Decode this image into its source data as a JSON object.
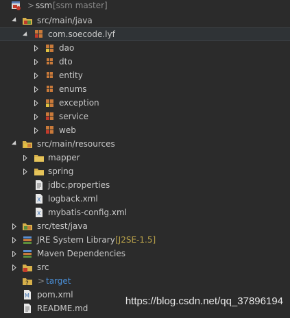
{
  "project": {
    "prefix": ">",
    "name": "ssm",
    "branch": "[ssm master]"
  },
  "tree": {
    "src_main_java": "src/main/java",
    "package": "com.soecode.lyf",
    "packages": [
      "dao",
      "dto",
      "entity",
      "enums",
      "exception",
      "service",
      "web"
    ],
    "src_main_resources": "src/main/resources",
    "folders": [
      "mapper",
      "spring"
    ],
    "files": [
      "jdbc.properties",
      "logback.xml",
      "mybatis-config.xml"
    ],
    "src_test_java": "src/test/java",
    "jre": {
      "label": "JRE System Library",
      "version": "[J2SE-1.5]"
    },
    "maven": "Maven Dependencies",
    "src": "src",
    "target": {
      "prefix": ">",
      "name": "target"
    },
    "pom": "pom.xml",
    "readme": "README.md"
  },
  "watermark": "https://blog.csdn.net/qq_37896194",
  "colors": {
    "background": "#2b2b2b",
    "text": "#c8c8c8",
    "branch": "#8a8a8a",
    "version": "#b9a24a",
    "target": "#4a90d9"
  }
}
